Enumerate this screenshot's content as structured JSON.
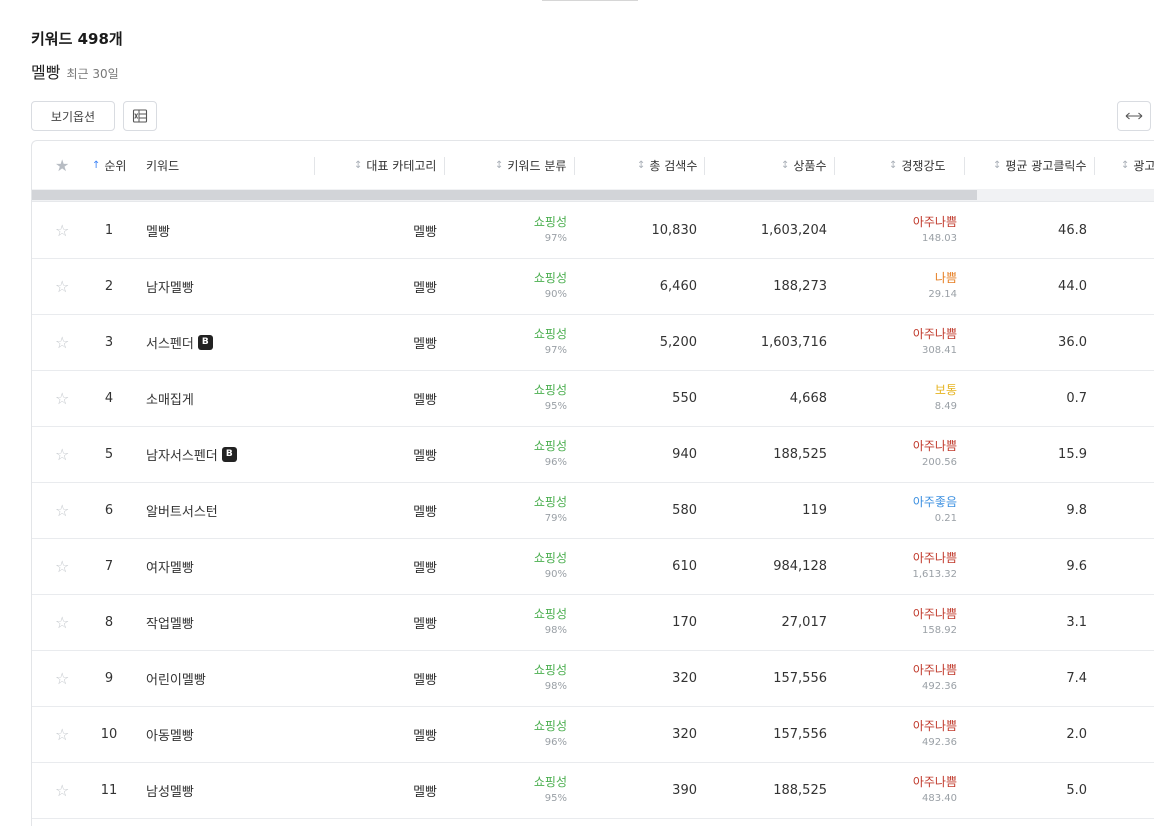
{
  "header": {
    "title": "키워드 498개",
    "keyword": "멜빵",
    "period": "최근 30일"
  },
  "toolbar": {
    "view_options_label": "보기옵션",
    "excel_icon": "excel-icon",
    "expand_icon": "expand-horizontal-icon"
  },
  "colors": {
    "shopping": "#4caf50",
    "very_bad": "#c0392b",
    "bad": "#e67e22",
    "normal": "#e6b422",
    "very_good": "#3b8fe0",
    "sort_active": "#3b82f6"
  },
  "columns": {
    "rank": "순위",
    "keyword": "키워드",
    "category": "대표 카테고리",
    "classification": "키워드 분류",
    "total_search": "총 검색수",
    "products": "상품수",
    "competition": "경쟁강도",
    "avg_ad_clicks": "평균 광고클릭수",
    "ad_partial": "광고"
  },
  "rows": [
    {
      "rank": "1",
      "keyword": "멜빵",
      "badge": "",
      "category": "멜빵",
      "class": "쇼핑성",
      "class_pct": "97%",
      "search": "10,830",
      "products": "1,603,204",
      "comp": "아주나쁨",
      "comp_level": "very_bad",
      "comp_val": "148.03",
      "clicks": "46.8"
    },
    {
      "rank": "2",
      "keyword": "남자멜빵",
      "badge": "",
      "category": "멜빵",
      "class": "쇼핑성",
      "class_pct": "90%",
      "search": "6,460",
      "products": "188,273",
      "comp": "나쁨",
      "comp_level": "bad",
      "comp_val": "29.14",
      "clicks": "44.0"
    },
    {
      "rank": "3",
      "keyword": "서스펜더",
      "badge": "B",
      "category": "멜빵",
      "class": "쇼핑성",
      "class_pct": "97%",
      "search": "5,200",
      "products": "1,603,716",
      "comp": "아주나쁨",
      "comp_level": "very_bad",
      "comp_val": "308.41",
      "clicks": "36.0"
    },
    {
      "rank": "4",
      "keyword": "소매집게",
      "badge": "",
      "category": "멜빵",
      "class": "쇼핑성",
      "class_pct": "95%",
      "search": "550",
      "products": "4,668",
      "comp": "보통",
      "comp_level": "normal",
      "comp_val": "8.49",
      "clicks": "0.7"
    },
    {
      "rank": "5",
      "keyword": "남자서스펜더",
      "badge": "B",
      "category": "멜빵",
      "class": "쇼핑성",
      "class_pct": "96%",
      "search": "940",
      "products": "188,525",
      "comp": "아주나쁨",
      "comp_level": "very_bad",
      "comp_val": "200.56",
      "clicks": "15.9"
    },
    {
      "rank": "6",
      "keyword": "알버트서스턴",
      "badge": "",
      "category": "멜빵",
      "class": "쇼핑성",
      "class_pct": "79%",
      "search": "580",
      "products": "119",
      "comp": "아주좋음",
      "comp_level": "very_good",
      "comp_val": "0.21",
      "clicks": "9.8"
    },
    {
      "rank": "7",
      "keyword": "여자멜빵",
      "badge": "",
      "category": "멜빵",
      "class": "쇼핑성",
      "class_pct": "90%",
      "search": "610",
      "products": "984,128",
      "comp": "아주나쁨",
      "comp_level": "very_bad",
      "comp_val": "1,613.32",
      "clicks": "9.6"
    },
    {
      "rank": "8",
      "keyword": "작업멜빵",
      "badge": "",
      "category": "멜빵",
      "class": "쇼핑성",
      "class_pct": "98%",
      "search": "170",
      "products": "27,017",
      "comp": "아주나쁨",
      "comp_level": "very_bad",
      "comp_val": "158.92",
      "clicks": "3.1"
    },
    {
      "rank": "9",
      "keyword": "어린이멜빵",
      "badge": "",
      "category": "멜빵",
      "class": "쇼핑성",
      "class_pct": "98%",
      "search": "320",
      "products": "157,556",
      "comp": "아주나쁨",
      "comp_level": "very_bad",
      "comp_val": "492.36",
      "clicks": "7.4"
    },
    {
      "rank": "10",
      "keyword": "아동멜빵",
      "badge": "",
      "category": "멜빵",
      "class": "쇼핑성",
      "class_pct": "96%",
      "search": "320",
      "products": "157,556",
      "comp": "아주나쁨",
      "comp_level": "very_bad",
      "comp_val": "492.36",
      "clicks": "2.0"
    },
    {
      "rank": "11",
      "keyword": "남성멜빵",
      "badge": "",
      "category": "멜빵",
      "class": "쇼핑성",
      "class_pct": "95%",
      "search": "390",
      "products": "188,525",
      "comp": "아주나쁨",
      "comp_level": "very_bad",
      "comp_val": "483.40",
      "clicks": "5.0"
    }
  ]
}
